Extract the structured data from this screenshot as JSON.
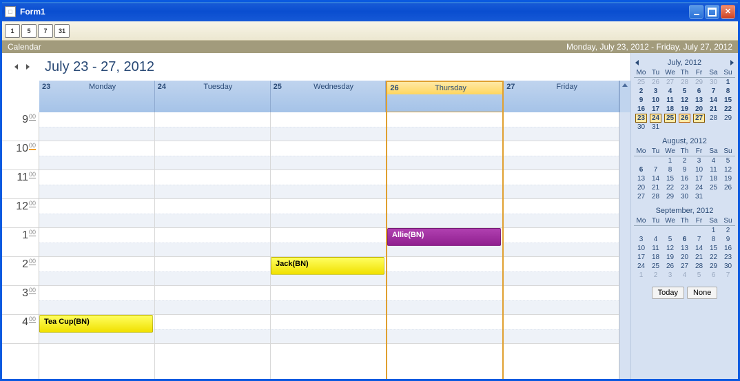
{
  "window": {
    "title": "Form1"
  },
  "toolbar": {
    "buttons": [
      "1",
      "5",
      "7",
      "31"
    ]
  },
  "header": {
    "label": "Calendar",
    "range_full": "Monday, July 23, 2012 - Friday, July 27, 2012"
  },
  "schedule": {
    "range_title": "July 23 - 27, 2012",
    "selected_day_index": 3,
    "days": [
      {
        "num": "23",
        "name": "Monday"
      },
      {
        "num": "24",
        "name": "Tuesday"
      },
      {
        "num": "25",
        "name": "Wednesday"
      },
      {
        "num": "26",
        "name": "Thursday"
      },
      {
        "num": "27",
        "name": "Friday"
      }
    ],
    "hours": [
      "9",
      "10",
      "11",
      "12",
      "1",
      "2",
      "3",
      "4"
    ],
    "current_hour_index": 1,
    "appointments": [
      {
        "day": 0,
        "hour_index": 7,
        "label": "Tea Cup(BN)",
        "color": "yellow"
      },
      {
        "day": 2,
        "hour_index": 5,
        "label": "Jack(BN)",
        "color": "yellow"
      },
      {
        "day": 3,
        "hour_index": 4,
        "label": "Allie(BN)",
        "color": "purple"
      }
    ]
  },
  "datepicker": {
    "today_label": "Today",
    "none_label": "None",
    "dow": [
      "Mo",
      "Tu",
      "We",
      "Th",
      "Fr",
      "Sa",
      "Su"
    ],
    "months": [
      {
        "title": "July, 2012",
        "nav": true,
        "weeks": [
          [
            {
              "d": "25",
              "o": 1
            },
            {
              "d": "26",
              "o": 1
            },
            {
              "d": "27",
              "o": 1
            },
            {
              "d": "28",
              "o": 1
            },
            {
              "d": "29",
              "o": 1
            },
            {
              "d": "30",
              "o": 1
            },
            {
              "d": "1",
              "b": 1
            }
          ],
          [
            {
              "d": "2",
              "b": 1
            },
            {
              "d": "3",
              "b": 1
            },
            {
              "d": "4",
              "b": 1
            },
            {
              "d": "5",
              "b": 1
            },
            {
              "d": "6",
              "b": 1
            },
            {
              "d": "7",
              "b": 1
            },
            {
              "d": "8",
              "b": 1
            }
          ],
          [
            {
              "d": "9",
              "b": 1
            },
            {
              "d": "10",
              "b": 1
            },
            {
              "d": "11",
              "b": 1
            },
            {
              "d": "12",
              "b": 1
            },
            {
              "d": "13",
              "b": 1
            },
            {
              "d": "14",
              "b": 1
            },
            {
              "d": "15",
              "b": 1
            }
          ],
          [
            {
              "d": "16",
              "b": 1
            },
            {
              "d": "17",
              "b": 1
            },
            {
              "d": "18",
              "b": 1
            },
            {
              "d": "19",
              "b": 1
            },
            {
              "d": "20",
              "b": 1
            },
            {
              "d": "21",
              "b": 1
            },
            {
              "d": "22",
              "b": 1
            }
          ],
          [
            {
              "d": "23",
              "b": 1,
              "sel": 1
            },
            {
              "d": "24",
              "b": 1,
              "sel": 1
            },
            {
              "d": "25",
              "b": 1,
              "sel": 1
            },
            {
              "d": "26",
              "b": 1,
              "sel": 1,
              "today": 1
            },
            {
              "d": "27",
              "b": 1,
              "sel": 1
            },
            {
              "d": "28"
            },
            {
              "d": "29"
            }
          ],
          [
            {
              "d": "30"
            },
            {
              "d": "31"
            },
            {
              "d": ""
            },
            {
              "d": ""
            },
            {
              "d": ""
            },
            {
              "d": ""
            },
            {
              "d": ""
            }
          ]
        ]
      },
      {
        "title": "August, 2012",
        "nav": false,
        "weeks": [
          [
            {
              "d": ""
            },
            {
              "d": ""
            },
            {
              "d": "1"
            },
            {
              "d": "2"
            },
            {
              "d": "3"
            },
            {
              "d": "4"
            },
            {
              "d": "5"
            }
          ],
          [
            {
              "d": "6",
              "b": 1
            },
            {
              "d": "7"
            },
            {
              "d": "8"
            },
            {
              "d": "9"
            },
            {
              "d": "10"
            },
            {
              "d": "11"
            },
            {
              "d": "12"
            }
          ],
          [
            {
              "d": "13"
            },
            {
              "d": "14"
            },
            {
              "d": "15"
            },
            {
              "d": "16"
            },
            {
              "d": "17"
            },
            {
              "d": "18"
            },
            {
              "d": "19"
            }
          ],
          [
            {
              "d": "20"
            },
            {
              "d": "21"
            },
            {
              "d": "22"
            },
            {
              "d": "23"
            },
            {
              "d": "24"
            },
            {
              "d": "25"
            },
            {
              "d": "26"
            }
          ],
          [
            {
              "d": "27"
            },
            {
              "d": "28"
            },
            {
              "d": "29"
            },
            {
              "d": "30"
            },
            {
              "d": "31"
            },
            {
              "d": ""
            },
            {
              "d": ""
            }
          ]
        ]
      },
      {
        "title": "September, 2012",
        "nav": false,
        "weeks": [
          [
            {
              "d": ""
            },
            {
              "d": ""
            },
            {
              "d": ""
            },
            {
              "d": ""
            },
            {
              "d": ""
            },
            {
              "d": "1"
            },
            {
              "d": "2"
            }
          ],
          [
            {
              "d": "3"
            },
            {
              "d": "4"
            },
            {
              "d": "5"
            },
            {
              "d": "6",
              "b": 1
            },
            {
              "d": "7"
            },
            {
              "d": "8"
            },
            {
              "d": "9"
            }
          ],
          [
            {
              "d": "10"
            },
            {
              "d": "11"
            },
            {
              "d": "12"
            },
            {
              "d": "13"
            },
            {
              "d": "14"
            },
            {
              "d": "15"
            },
            {
              "d": "16"
            }
          ],
          [
            {
              "d": "17"
            },
            {
              "d": "18"
            },
            {
              "d": "19"
            },
            {
              "d": "20"
            },
            {
              "d": "21"
            },
            {
              "d": "22"
            },
            {
              "d": "23"
            }
          ],
          [
            {
              "d": "24"
            },
            {
              "d": "25"
            },
            {
              "d": "26"
            },
            {
              "d": "27"
            },
            {
              "d": "28"
            },
            {
              "d": "29"
            },
            {
              "d": "30"
            }
          ],
          [
            {
              "d": "1",
              "o": 1
            },
            {
              "d": "2",
              "o": 1
            },
            {
              "d": "3",
              "o": 1
            },
            {
              "d": "4",
              "o": 1
            },
            {
              "d": "5",
              "o": 1
            },
            {
              "d": "6",
              "o": 1
            },
            {
              "d": "7",
              "o": 1
            }
          ]
        ]
      }
    ]
  }
}
